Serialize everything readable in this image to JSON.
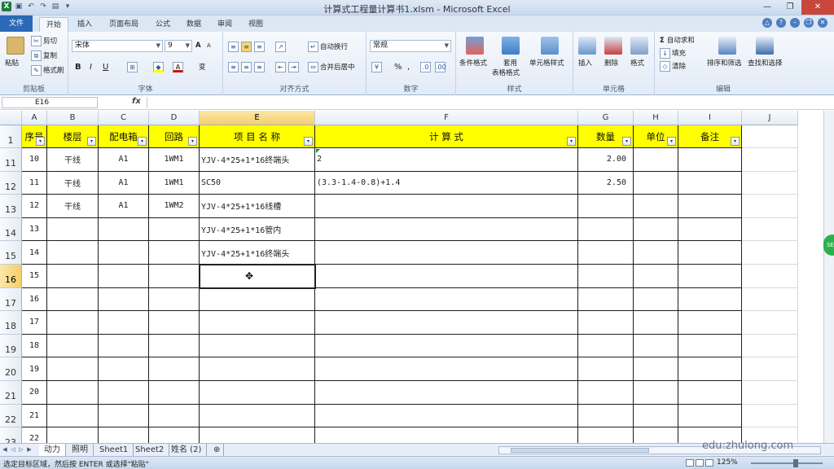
{
  "window": {
    "title": "计算式工程量计算书1.xlsm - Microsoft Excel"
  },
  "ribbon_tabs": [
    "文件",
    "开始",
    "插入",
    "页面布局",
    "公式",
    "数据",
    "审阅",
    "视图"
  ],
  "ribbon": {
    "clipboard": {
      "paste": "粘贴",
      "cut": "剪切",
      "copy": "复制",
      "format_painter": "格式刷",
      "label": "剪贴板"
    },
    "font": {
      "name": "宋体",
      "size": "9",
      "bold": "B",
      "italic": "I",
      "underline": "U",
      "label": "字体",
      "grow": "A",
      "shrink": "A",
      "phonetic": "变"
    },
    "alignment": {
      "wrap": "自动换行",
      "merge": "合并后居中",
      "label": "对齐方式"
    },
    "number": {
      "format": "常规",
      "percent": "%",
      "comma": ",",
      "label": "数字"
    },
    "styles": {
      "cond_format": "条件格式",
      "table_format_1": "套用",
      "table_format_2": "表格格式",
      "cell_styles": "单元格样式",
      "label": "样式"
    },
    "cells": {
      "insert": "插入",
      "delete": "删除",
      "format": "格式",
      "label": "单元格"
    },
    "editing": {
      "autosum": "自动求和",
      "fill": "填充",
      "clear": "清除",
      "sort_filter": "排序和筛选",
      "find_select": "查找和选择",
      "label": "编辑"
    }
  },
  "formula_bar": {
    "name_box": "E16",
    "fx": "fx",
    "formula": ""
  },
  "columns": [
    "A",
    "B",
    "C",
    "D",
    "E",
    "F",
    "G",
    "H",
    "I",
    "J"
  ],
  "header_row": {
    "row_number": "1",
    "cells": [
      "序号",
      "楼层",
      "配电箱",
      "回路",
      "项 目 名 称",
      "计    算    式",
      "数量",
      "单位",
      "备注"
    ]
  },
  "rows": [
    {
      "row_number": "11",
      "cells": [
        "10",
        "干线",
        "A1",
        "1WM1",
        "YJV-4*25+1*16终端头",
        "2",
        "2.00",
        "",
        ""
      ]
    },
    {
      "row_number": "12",
      "cells": [
        "11",
        "干线",
        "A1",
        "1WM1",
        "SC50",
        "(3.3-1.4-0.8)+1.4",
        "2.50",
        "",
        ""
      ]
    },
    {
      "row_number": "13",
      "cells": [
        "12",
        "干线",
        "A1",
        "1WM2",
        "YJV-4*25+1*16线槽",
        "",
        "",
        "",
        ""
      ]
    },
    {
      "row_number": "14",
      "cells": [
        "13",
        "",
        "",
        "",
        "YJV-4*25+1*16管内",
        "",
        "",
        "",
        ""
      ]
    },
    {
      "row_number": "15",
      "cells": [
        "14",
        "",
        "",
        "",
        "YJV-4*25+1*16终端头",
        "",
        "",
        "",
        ""
      ]
    },
    {
      "row_number": "16",
      "cells": [
        "15",
        "",
        "",
        "",
        "",
        "",
        "",
        "",
        ""
      ]
    },
    {
      "row_number": "17",
      "cells": [
        "16",
        "",
        "",
        "",
        "",
        "",
        "",
        "",
        ""
      ]
    },
    {
      "row_number": "18",
      "cells": [
        "17",
        "",
        "",
        "",
        "",
        "",
        "",
        "",
        ""
      ]
    },
    {
      "row_number": "19",
      "cells": [
        "18",
        "",
        "",
        "",
        "",
        "",
        "",
        "",
        ""
      ]
    },
    {
      "row_number": "20",
      "cells": [
        "19",
        "",
        "",
        "",
        "",
        "",
        "",
        "",
        ""
      ]
    },
    {
      "row_number": "21",
      "cells": [
        "20",
        "",
        "",
        "",
        "",
        "",
        "",
        "",
        ""
      ]
    },
    {
      "row_number": "22",
      "cells": [
        "21",
        "",
        "",
        "",
        "",
        "",
        "",
        "",
        ""
      ]
    },
    {
      "row_number": "23",
      "cells": [
        "22",
        "",
        "",
        "",
        "",
        "",
        "",
        "",
        ""
      ]
    }
  ],
  "sheets": [
    "动力",
    "照明",
    "Sheet1",
    "Sheet2",
    "姓名 (2)"
  ],
  "status": {
    "message": "选定目标区域，然后按 ENTER 或选择\"粘贴\"",
    "zoom": "125%"
  },
  "watermark": "edu:zhulong.com",
  "overlay_badge": "SE",
  "colors": {
    "header_fill": "#ffff00",
    "file_tab": "#2a6ab6",
    "selection_header": "#f4cf6a"
  }
}
